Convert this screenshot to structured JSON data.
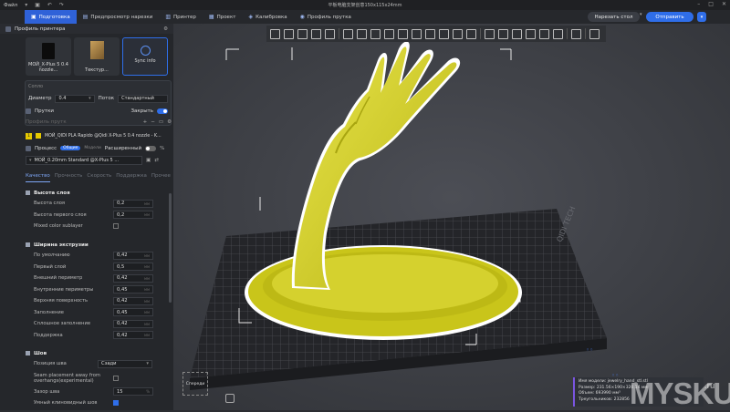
{
  "window": {
    "title": "平板电脑支架创意150x115x24mm",
    "menu": "Файл"
  },
  "tabs": [
    {
      "label": "Подготовка"
    },
    {
      "label": "Предпросмотр нарезки"
    },
    {
      "label": "Принтер"
    },
    {
      "label": "Проект"
    },
    {
      "label": "Калибровка"
    },
    {
      "label": "Профиль прутка"
    }
  ],
  "actions": {
    "slice": "Нарезать стол",
    "send": "Отправить"
  },
  "printer": {
    "section": "Профиль принтера",
    "printer_card": "МОЙ_X-Plus 5 0.4 nozzle...",
    "texture_card": "Текстур...",
    "sync_card": "Sync info",
    "nozzle_group": "Сопло",
    "diameter_label": "Диаметр",
    "diameter_value": "0.4",
    "flow_label": "Поток",
    "flow_value": "Стандартный"
  },
  "filament": {
    "section": "Прутки",
    "close_label": "Закрыть",
    "profile_placeholder": "Профиль прутк",
    "slot_number": "1",
    "item": "МОЙ_QIDI PLA Rapido @Qidi X-Plus 5 0.4 nozzle - K...",
    "color": "#e6c900"
  },
  "process": {
    "section": "Процесс",
    "mode_general": "Общие",
    "mode_models": "Модели",
    "advanced_label": "Расширенный",
    "preset": "МОЙ_0.20mm Standard @X-Plus 5 ..."
  },
  "subtabs": [
    {
      "label": "Качество",
      "active": true
    },
    {
      "label": "Прочность",
      "active": false
    },
    {
      "label": "Скорость",
      "active": false
    },
    {
      "label": "Поддержка",
      "active": false
    },
    {
      "label": "Прочее",
      "active": false
    }
  ],
  "layer_height": {
    "title": "Высота слоя",
    "rows": [
      {
        "name": "Высота слоя",
        "value": "0,2",
        "unit": "мм"
      },
      {
        "name": "Высота первого слоя",
        "value": "0,2",
        "unit": "мм"
      }
    ],
    "mixed_label": "Mixed color sublayer"
  },
  "line_width": {
    "title": "Ширина экструзии",
    "rows": [
      {
        "name": "По умолчанию",
        "value": "0,42",
        "unit": "мм"
      },
      {
        "name": "Первый слой",
        "value": "0,5",
        "unit": "мм"
      },
      {
        "name": "Внешний периметр",
        "value": "0,42",
        "unit": "мм"
      },
      {
        "name": "Внутренние периметры",
        "value": "0,45",
        "unit": "мм"
      },
      {
        "name": "Верхняя поверхность",
        "value": "0,42",
        "unit": "мм"
      },
      {
        "name": "Заполнение",
        "value": "0,45",
        "unit": "мм"
      },
      {
        "name": "Сплошное заполнение",
        "value": "0,42",
        "unit": "мм"
      },
      {
        "name": "Поддержка",
        "value": "0,42",
        "unit": "мм"
      }
    ]
  },
  "seam": {
    "title": "Шов",
    "position_label": "Позиция шва",
    "position_value": "Сзади",
    "away_label_1": "Seam placement away from",
    "away_label_2": "overhangs(experimental)",
    "gap_label": "Зазор шва",
    "gap_value": "15",
    "gap_unit": "%",
    "scarf_label": "Умный клиновидный шов"
  },
  "viewport": {
    "plate_label": "QIDI TECH",
    "ghost_label": "Спереди",
    "model_color": "#d8d426",
    "stats": {
      "name": "Имя модели: jewelry_hand_stl.stl",
      "size": "Размер: 231.56×190×320.14 мм",
      "volume": "Объем: 693990 мм³",
      "triangles": "Треугольников: 232856"
    }
  },
  "watermark": {
    "main": "MYSKU",
    "suffix": ".ru"
  }
}
